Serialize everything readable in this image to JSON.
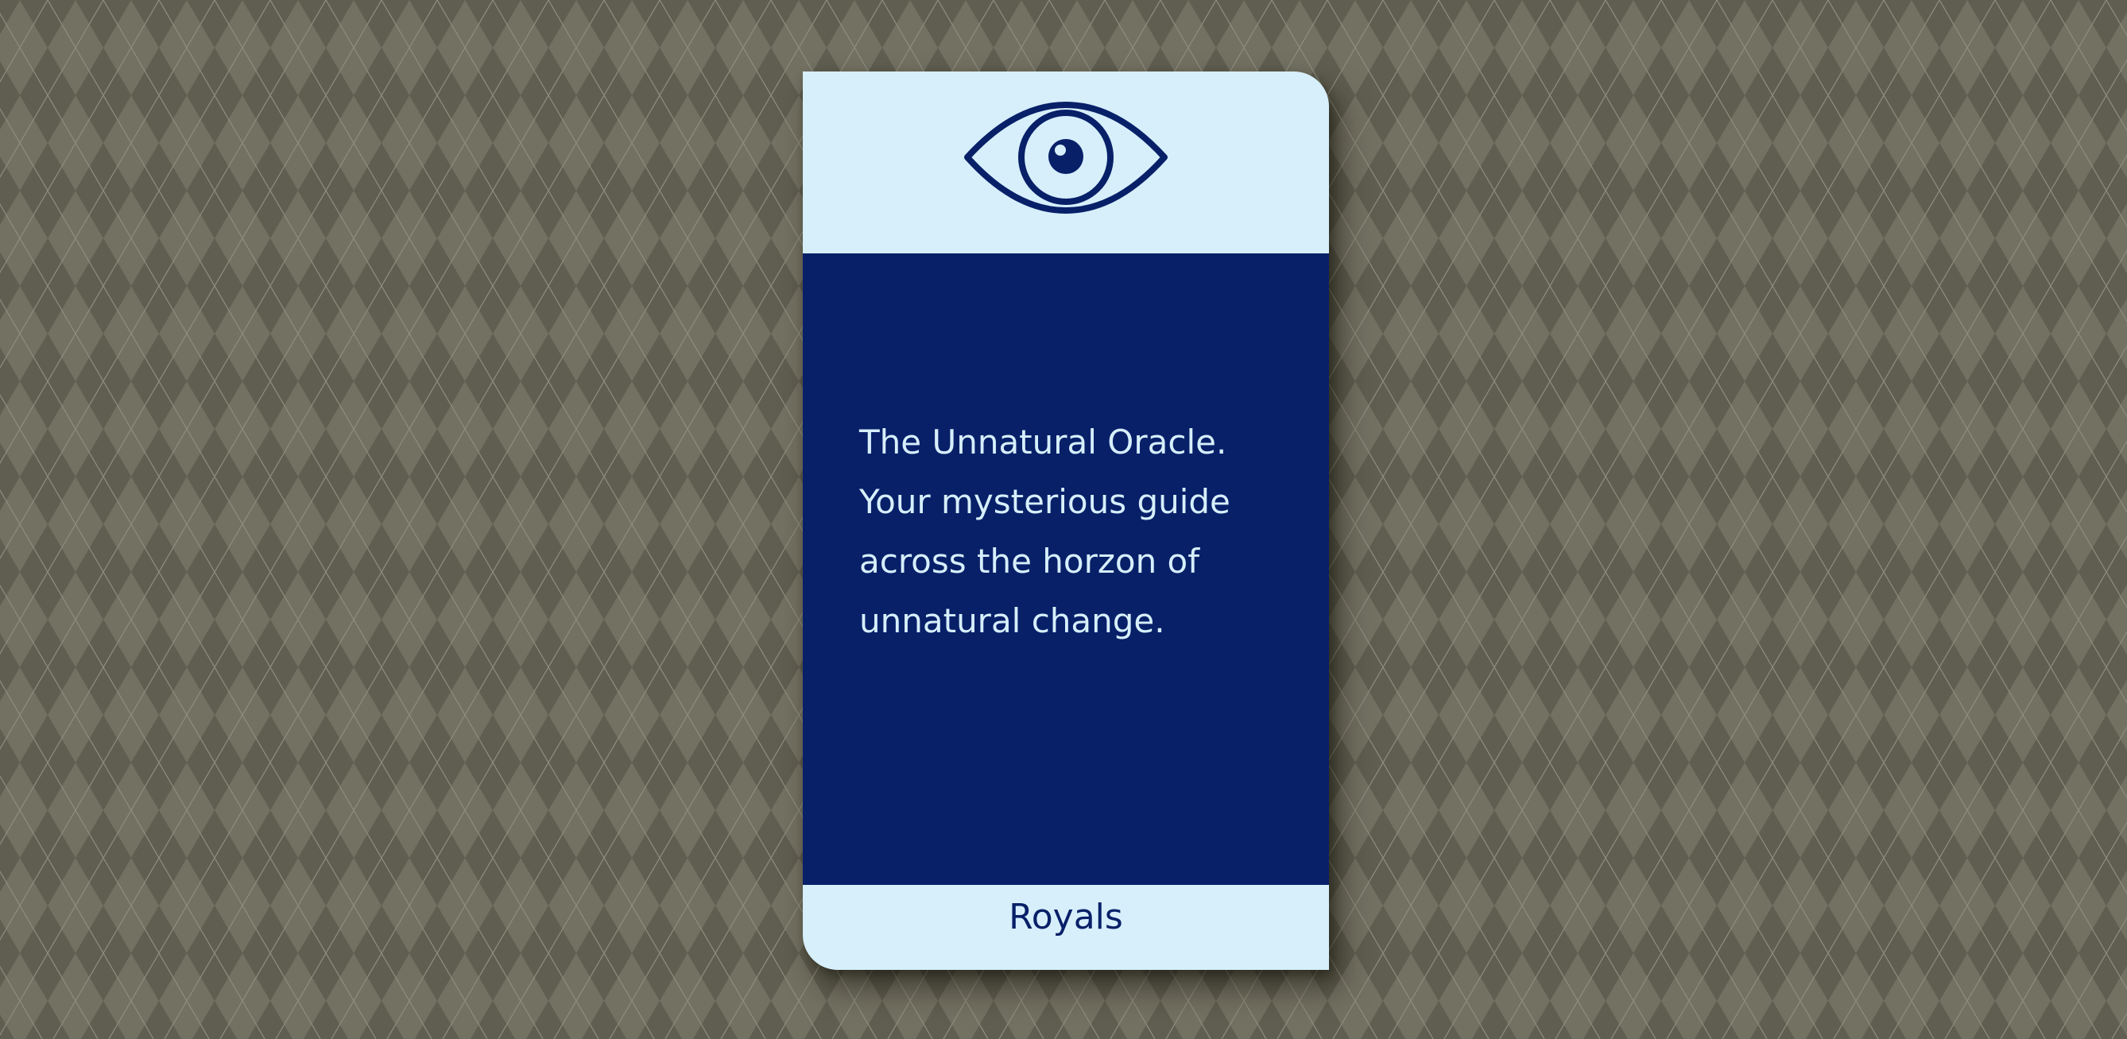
{
  "background": {
    "base_color": "#6b6959",
    "diamond_light_color": "#737162",
    "diamond_dark_color": "#605e50",
    "line_color": "#8e8c7d"
  },
  "card": {
    "icon": "eye-icon",
    "description_lines": [
      "The Unnatural Oracle.",
      "Your mysterious guide",
      "across the horzon of",
      "unnatural change."
    ],
    "name": "Royals",
    "colors": {
      "panel_light": "#d6effb",
      "panel_dark": "#082068",
      "text_light": "#d6effb",
      "text_dark": "#082068"
    }
  }
}
